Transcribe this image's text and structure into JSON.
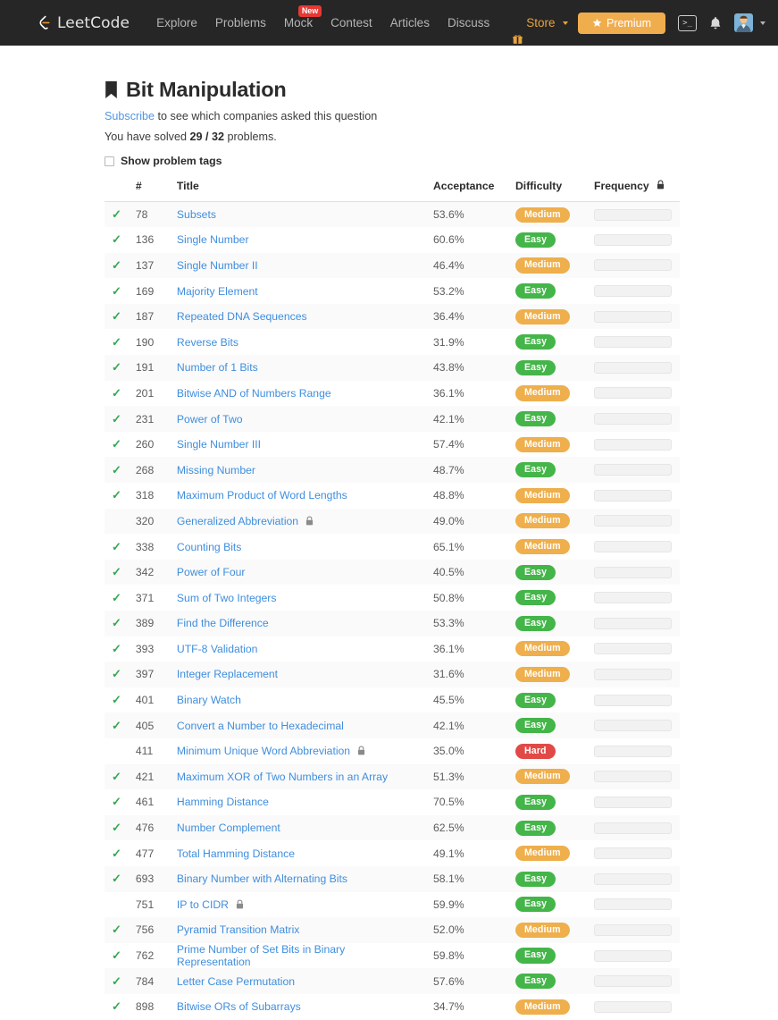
{
  "navbar": {
    "brand": "LeetCode",
    "links": [
      {
        "label": "Explore",
        "badge": null
      },
      {
        "label": "Problems",
        "badge": null
      },
      {
        "label": "Mock",
        "badge": "New"
      },
      {
        "label": "Contest",
        "badge": null
      },
      {
        "label": "Articles",
        "badge": null
      },
      {
        "label": "Discuss",
        "badge": null
      }
    ],
    "store_label": "Store",
    "premium_label": "Premium",
    "console_glyph": ">_",
    "icons": {
      "gift": "gift-icon",
      "star": "star-icon",
      "console": "console-icon",
      "bell": "bell-icon",
      "avatar": "avatar-icon",
      "caret": "chevron-down-icon"
    },
    "colors": {
      "background": "#262626",
      "link": "#b4b4b4",
      "store": "#e8a33d",
      "premium_bg": "#f0ad4e",
      "new_badge_bg": "#e53935"
    }
  },
  "page": {
    "title": "Bit Manipulation",
    "bookmark_icon": "bookmark-icon",
    "subscribe_link": "Subscribe",
    "subscribe_rest": " to see which companies asked this question",
    "solved_prefix": "You have solved ",
    "solved_count": "29 / 32",
    "solved_suffix": " problems.",
    "show_tags_label": "Show problem tags",
    "show_tags_checked": false
  },
  "table": {
    "headers": {
      "status": "",
      "number": "#",
      "title": "Title",
      "acceptance": "Acceptance",
      "difficulty": "Difficulty",
      "frequency": "Frequency"
    },
    "frequency_locked": true,
    "rows": [
      {
        "solved": true,
        "num": "78",
        "title": "Subsets",
        "locked": false,
        "acceptance": "53.6%",
        "difficulty": "Medium"
      },
      {
        "solved": true,
        "num": "136",
        "title": "Single Number",
        "locked": false,
        "acceptance": "60.6%",
        "difficulty": "Easy"
      },
      {
        "solved": true,
        "num": "137",
        "title": "Single Number II",
        "locked": false,
        "acceptance": "46.4%",
        "difficulty": "Medium"
      },
      {
        "solved": true,
        "num": "169",
        "title": "Majority Element",
        "locked": false,
        "acceptance": "53.2%",
        "difficulty": "Easy"
      },
      {
        "solved": true,
        "num": "187",
        "title": "Repeated DNA Sequences",
        "locked": false,
        "acceptance": "36.4%",
        "difficulty": "Medium"
      },
      {
        "solved": true,
        "num": "190",
        "title": "Reverse Bits",
        "locked": false,
        "acceptance": "31.9%",
        "difficulty": "Easy"
      },
      {
        "solved": true,
        "num": "191",
        "title": "Number of 1 Bits",
        "locked": false,
        "acceptance": "43.8%",
        "difficulty": "Easy"
      },
      {
        "solved": true,
        "num": "201",
        "title": "Bitwise AND of Numbers Range",
        "locked": false,
        "acceptance": "36.1%",
        "difficulty": "Medium"
      },
      {
        "solved": true,
        "num": "231",
        "title": "Power of Two",
        "locked": false,
        "acceptance": "42.1%",
        "difficulty": "Easy"
      },
      {
        "solved": true,
        "num": "260",
        "title": "Single Number III",
        "locked": false,
        "acceptance": "57.4%",
        "difficulty": "Medium"
      },
      {
        "solved": true,
        "num": "268",
        "title": "Missing Number",
        "locked": false,
        "acceptance": "48.7%",
        "difficulty": "Easy"
      },
      {
        "solved": true,
        "num": "318",
        "title": "Maximum Product of Word Lengths",
        "locked": false,
        "acceptance": "48.8%",
        "difficulty": "Medium"
      },
      {
        "solved": false,
        "num": "320",
        "title": "Generalized Abbreviation",
        "locked": true,
        "acceptance": "49.0%",
        "difficulty": "Medium"
      },
      {
        "solved": true,
        "num": "338",
        "title": "Counting Bits",
        "locked": false,
        "acceptance": "65.1%",
        "difficulty": "Medium"
      },
      {
        "solved": true,
        "num": "342",
        "title": "Power of Four",
        "locked": false,
        "acceptance": "40.5%",
        "difficulty": "Easy"
      },
      {
        "solved": true,
        "num": "371",
        "title": "Sum of Two Integers",
        "locked": false,
        "acceptance": "50.8%",
        "difficulty": "Easy"
      },
      {
        "solved": true,
        "num": "389",
        "title": "Find the Difference",
        "locked": false,
        "acceptance": "53.3%",
        "difficulty": "Easy"
      },
      {
        "solved": true,
        "num": "393",
        "title": "UTF-8 Validation",
        "locked": false,
        "acceptance": "36.1%",
        "difficulty": "Medium"
      },
      {
        "solved": true,
        "num": "397",
        "title": "Integer Replacement",
        "locked": false,
        "acceptance": "31.6%",
        "difficulty": "Medium"
      },
      {
        "solved": true,
        "num": "401",
        "title": "Binary Watch",
        "locked": false,
        "acceptance": "45.5%",
        "difficulty": "Easy"
      },
      {
        "solved": true,
        "num": "405",
        "title": "Convert a Number to Hexadecimal",
        "locked": false,
        "acceptance": "42.1%",
        "difficulty": "Easy"
      },
      {
        "solved": false,
        "num": "411",
        "title": "Minimum Unique Word Abbreviation",
        "locked": true,
        "acceptance": "35.0%",
        "difficulty": "Hard"
      },
      {
        "solved": true,
        "num": "421",
        "title": "Maximum XOR of Two Numbers in an Array",
        "locked": false,
        "acceptance": "51.3%",
        "difficulty": "Medium"
      },
      {
        "solved": true,
        "num": "461",
        "title": "Hamming Distance",
        "locked": false,
        "acceptance": "70.5%",
        "difficulty": "Easy"
      },
      {
        "solved": true,
        "num": "476",
        "title": "Number Complement",
        "locked": false,
        "acceptance": "62.5%",
        "difficulty": "Easy"
      },
      {
        "solved": true,
        "num": "477",
        "title": "Total Hamming Distance",
        "locked": false,
        "acceptance": "49.1%",
        "difficulty": "Medium"
      },
      {
        "solved": true,
        "num": "693",
        "title": "Binary Number with Alternating Bits",
        "locked": false,
        "acceptance": "58.1%",
        "difficulty": "Easy"
      },
      {
        "solved": false,
        "num": "751",
        "title": "IP to CIDR",
        "locked": true,
        "acceptance": "59.9%",
        "difficulty": "Easy"
      },
      {
        "solved": true,
        "num": "756",
        "title": "Pyramid Transition Matrix",
        "locked": false,
        "acceptance": "52.0%",
        "difficulty": "Medium"
      },
      {
        "solved": true,
        "num": "762",
        "title": "Prime Number of Set Bits in Binary Representation",
        "locked": false,
        "acceptance": "59.8%",
        "difficulty": "Easy"
      },
      {
        "solved": true,
        "num": "784",
        "title": "Letter Case Permutation",
        "locked": false,
        "acceptance": "57.6%",
        "difficulty": "Easy"
      },
      {
        "solved": true,
        "num": "898",
        "title": "Bitwise ORs of Subarrays",
        "locked": false,
        "acceptance": "34.7%",
        "difficulty": "Medium"
      }
    ],
    "colors": {
      "easy": "#44b549",
      "medium": "#eeaf4c",
      "hard": "#e04a46",
      "link": "#3f8ede",
      "check": "#33a852"
    }
  }
}
